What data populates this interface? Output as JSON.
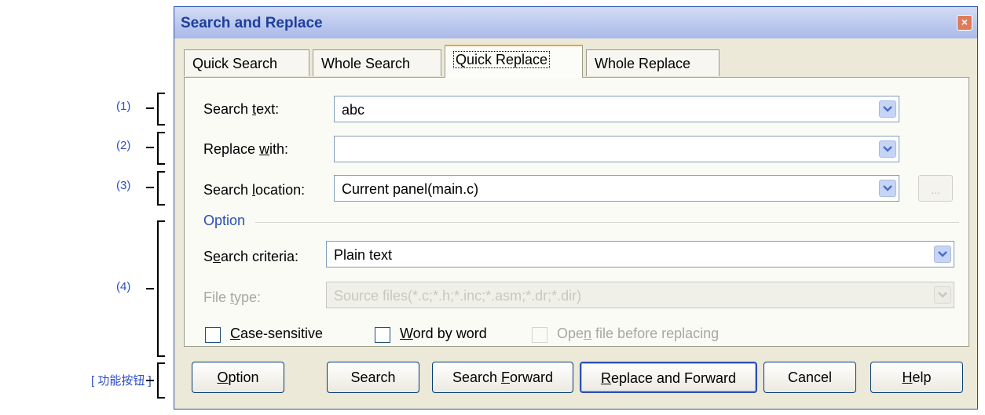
{
  "callouts": [
    "(1)",
    "(2)",
    "(3)",
    "(4)",
    "[ 功能按钮 ]"
  ],
  "window": {
    "title": "Search and Replace",
    "close_icon": "close-icon"
  },
  "tabs": [
    {
      "label": "Quick Search",
      "active": false
    },
    {
      "label": "Whole Search",
      "active": false
    },
    {
      "label": "Quick Replace",
      "active": true
    },
    {
      "label": "Whole Replace",
      "active": false
    }
  ],
  "fields": {
    "search_text": {
      "label_pre": "Search ",
      "label_key": "t",
      "label_post": "ext:",
      "value": "abc"
    },
    "replace_with": {
      "label_pre": "Replace ",
      "label_key": "w",
      "label_post": "ith:",
      "value": ""
    },
    "search_location": {
      "label_pre": "Search ",
      "label_key": "l",
      "label_post": "ocation:",
      "value": "Current panel(main.c)",
      "browse_label": "..."
    }
  },
  "option": {
    "section_title": "Option",
    "search_criteria": {
      "label_pre": "S",
      "label_key": "e",
      "label_post": "arch criteria:",
      "value": "Plain text"
    },
    "file_type": {
      "label_pre": "File ",
      "label_key": "t",
      "label_post": "ype:",
      "value": "Source files(*.c;*.h;*.inc;*.asm;*.dr;*.dir)"
    },
    "case_sensitive": {
      "label_key": "C",
      "label_post": "ase-sensitive",
      "checked": false
    },
    "word_by_word": {
      "label_key": "W",
      "label_post": "ord by word",
      "checked": false
    },
    "open_file": {
      "label_pre": "Ope",
      "label_key": "n",
      "label_post": " file before replacing",
      "checked": false
    }
  },
  "buttons": {
    "option": {
      "key": "O",
      "rest": "ption"
    },
    "search": "Search",
    "search_forward": {
      "pre": "Search ",
      "key": "F",
      "post": "orward"
    },
    "replace_forward": {
      "key": "R",
      "post": "eplace and Forward"
    },
    "cancel": "Cancel",
    "help": {
      "key": "H",
      "rest": "elp"
    }
  },
  "colors": {
    "accent": "#2a4fb5",
    "callout": "#2f4fc8",
    "tab_highlight": "#f1a33a"
  }
}
